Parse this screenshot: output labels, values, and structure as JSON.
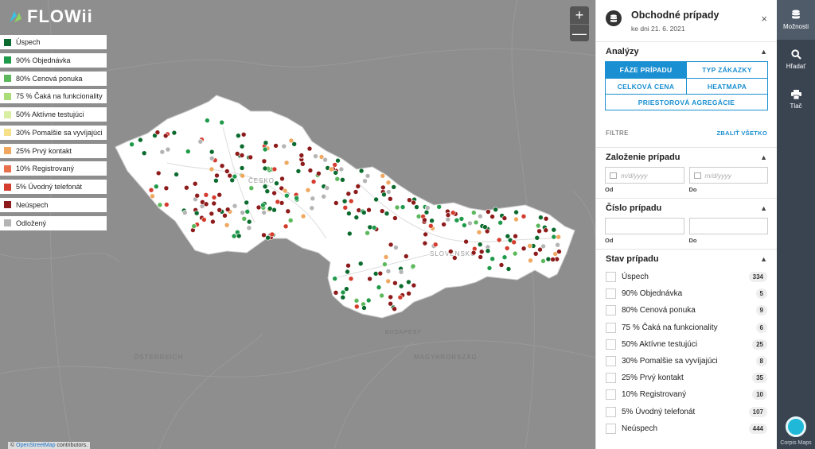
{
  "brand": {
    "name": "FLOWii"
  },
  "map": {
    "zoom_in": "+",
    "zoom_out": "—",
    "attribution_prefix": "©",
    "attribution_link": "OpenStreetMap",
    "attribution_suffix": "contributors.",
    "labels": {
      "cesko": "ČESKO",
      "slovensko": "SLOVENSKO",
      "oesterreich": "ÖSTERREICH",
      "magyarorszag": "MAGYARORSZÁG",
      "budapest": "BUDAPEST"
    }
  },
  "legend": [
    {
      "label": "Úspech",
      "color": "#0b6b2e"
    },
    {
      "label": "90% Objednávka",
      "color": "#1f9a4a"
    },
    {
      "label": "80% Cenová ponuka",
      "color": "#5cb85c"
    },
    {
      "label": "75 % Čaká na funkcionality",
      "color": "#a9dd77"
    },
    {
      "label": "50% Aktívne testujúci",
      "color": "#d8eea0"
    },
    {
      "label": "30% Pomalšie sa vyvíjajúci",
      "color": "#f6e08a"
    },
    {
      "label": "25% Prvý kontakt",
      "color": "#f0a860"
    },
    {
      "label": "10% Registrovaný",
      "color": "#e8704c"
    },
    {
      "label": "5% Úvodný telefonát",
      "color": "#d43c2e"
    },
    {
      "label": "Neúspech",
      "color": "#8e1b1b"
    },
    {
      "label": "Odložený",
      "color": "#b4b4b4"
    }
  ],
  "panel": {
    "title": "Obchodné prípady",
    "subtitle": "ke dni 21. 6. 2021",
    "close": "×",
    "analyzy": {
      "heading": "Analýzy",
      "tabs": {
        "faze": "FÁZE PRÍPADU",
        "typ": "TYP ZÁKAZKY",
        "cena": "CELKOVÁ CENA",
        "heatmapa": "HEATMAPA",
        "priestorova": "PRIESTOROVÁ AGREGÁCIE"
      }
    },
    "filtre": {
      "label": "FILTRE",
      "collapse": "ZBALIŤ VŠETKO"
    },
    "zalozenie": {
      "heading": "Založenie prípadu",
      "from_placeholder": "m/d/yyyy",
      "to_placeholder": "m/d/yyyy",
      "from_caption": "Od",
      "to_caption": "Do"
    },
    "cislo": {
      "heading": "Číslo prípadu",
      "from_caption": "Od",
      "to_caption": "Do"
    },
    "stav": {
      "heading": "Stav prípadu",
      "items": [
        {
          "label": "Úspech",
          "count": "334"
        },
        {
          "label": "90% Objednávka",
          "count": "5"
        },
        {
          "label": "80% Cenová ponuka",
          "count": "9"
        },
        {
          "label": "75 % Čaká na funkcionality",
          "count": "6"
        },
        {
          "label": "50% Aktívne testujúci",
          "count": "25"
        },
        {
          "label": "30% Pomalšie sa vyvíjajúci",
          "count": "8"
        },
        {
          "label": "25% Prvý kontakt",
          "count": "35"
        },
        {
          "label": "10% Registrovaný",
          "count": "10"
        },
        {
          "label": "5% Úvodný telefonát",
          "count": "107"
        },
        {
          "label": "Neúspech",
          "count": "444"
        }
      ]
    }
  },
  "sidebar": {
    "moznosti": "Možnosti",
    "hladat": "Hľadať",
    "tlac": "Tlač",
    "corpis": "Corpis Maps"
  }
}
